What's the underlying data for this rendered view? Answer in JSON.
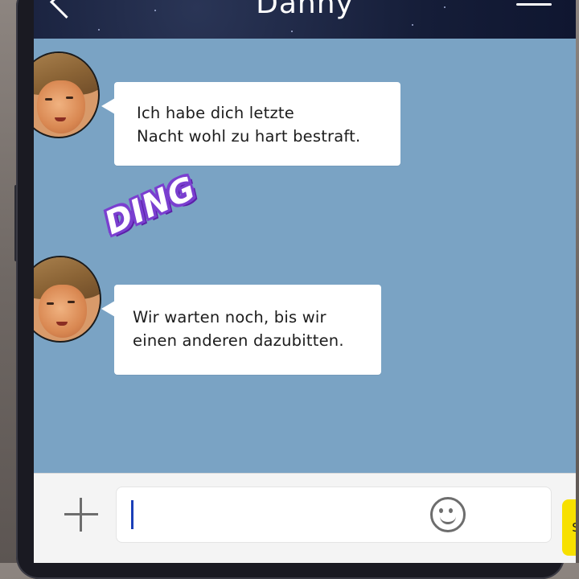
{
  "header": {
    "title": "Danny",
    "back_icon": "chevron-left-icon",
    "menu_icon": "hamburger-menu-icon"
  },
  "messages": [
    {
      "sender": "Danny",
      "avatar": "avatar",
      "lines": [
        "Ich habe dich letzte",
        "Nacht wohl zu hart bestraft."
      ]
    },
    {
      "sender": "Danny",
      "avatar": "avatar",
      "lines": [
        "Wir warten noch, bis wir",
        "einen anderen dazubitten."
      ]
    }
  ],
  "sound_effect": "DING",
  "input_bar": {
    "plus_icon": "plus-icon",
    "emoji_icon": "smiley-icon",
    "value": "",
    "send_label": "SENDEN"
  },
  "colors": {
    "chat_background": "#7aa3c4",
    "header_background": "#151d38",
    "send_button": "#f7e000",
    "sound_effect": "#7a3fd0"
  }
}
